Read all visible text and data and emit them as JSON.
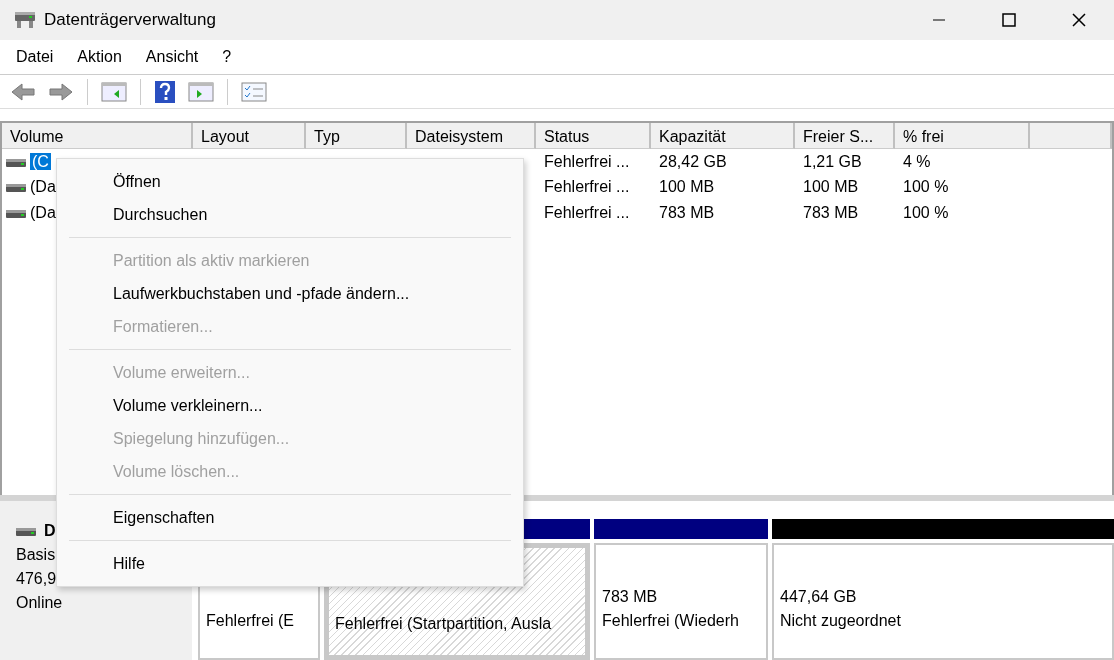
{
  "window": {
    "title": "Datenträgerverwaltung"
  },
  "menu_bar": [
    "Datei",
    "Aktion",
    "Ansicht",
    "?"
  ],
  "volume_table": {
    "columns": [
      "Volume",
      "Layout",
      "Typ",
      "Dateisystem",
      "Status",
      "Kapazität",
      "Freier S...",
      "% frei"
    ],
    "rows": [
      {
        "volume": "(C",
        "selected": true,
        "status": "Fehlerfrei ...",
        "capacity": "28,42 GB",
        "free": "1,21 GB",
        "percent_free": "4 %"
      },
      {
        "volume": "(Da",
        "selected": false,
        "status": "Fehlerfrei ...",
        "capacity": "100 MB",
        "free": "100 MB",
        "percent_free": "100 %"
      },
      {
        "volume": "(Da",
        "selected": false,
        "status": "Fehlerfrei ...",
        "capacity": "783 MB",
        "free": "783 MB",
        "percent_free": "100 %"
      }
    ]
  },
  "disk": {
    "name": "D",
    "type": "Basis",
    "size": "476,9",
    "state": "Online"
  },
  "partitions": [
    {
      "lines": [
        "Fehlerfrei (E"
      ],
      "hatched": false
    },
    {
      "color": "#000080",
      "lines": [
        "Fehlerfrei (Startpartition, Ausla"
      ],
      "hatched": true
    },
    {
      "color": "#000080",
      "lines": [
        "783 MB",
        "Fehlerfrei (Wiederh"
      ],
      "hatched": false
    },
    {
      "color": "#000000",
      "lines": [
        "447,64 GB",
        "Nicht zugeordnet"
      ],
      "hatched": false
    }
  ],
  "context_menu": {
    "items": [
      {
        "kind": "item",
        "label": "Öffnen",
        "disabled": false
      },
      {
        "kind": "item",
        "label": "Durchsuchen",
        "disabled": false
      },
      {
        "kind": "separator"
      },
      {
        "kind": "item",
        "label": "Partition als aktiv markieren",
        "disabled": true
      },
      {
        "kind": "item",
        "label": "Laufwerkbuchstaben und -pfade ändern...",
        "disabled": false
      },
      {
        "kind": "item",
        "label": "Formatieren...",
        "disabled": true
      },
      {
        "kind": "separator"
      },
      {
        "kind": "item",
        "label": "Volume erweitern...",
        "disabled": true
      },
      {
        "kind": "item",
        "label": "Volume verkleinern...",
        "disabled": false
      },
      {
        "kind": "item",
        "label": "Spiegelung hinzufügen...",
        "disabled": true
      },
      {
        "kind": "item",
        "label": "Volume löschen...",
        "disabled": true
      },
      {
        "kind": "separator"
      },
      {
        "kind": "item",
        "label": "Eigenschaften",
        "disabled": false
      },
      {
        "kind": "separator"
      },
      {
        "kind": "item",
        "label": "Hilfe",
        "disabled": false
      }
    ]
  }
}
